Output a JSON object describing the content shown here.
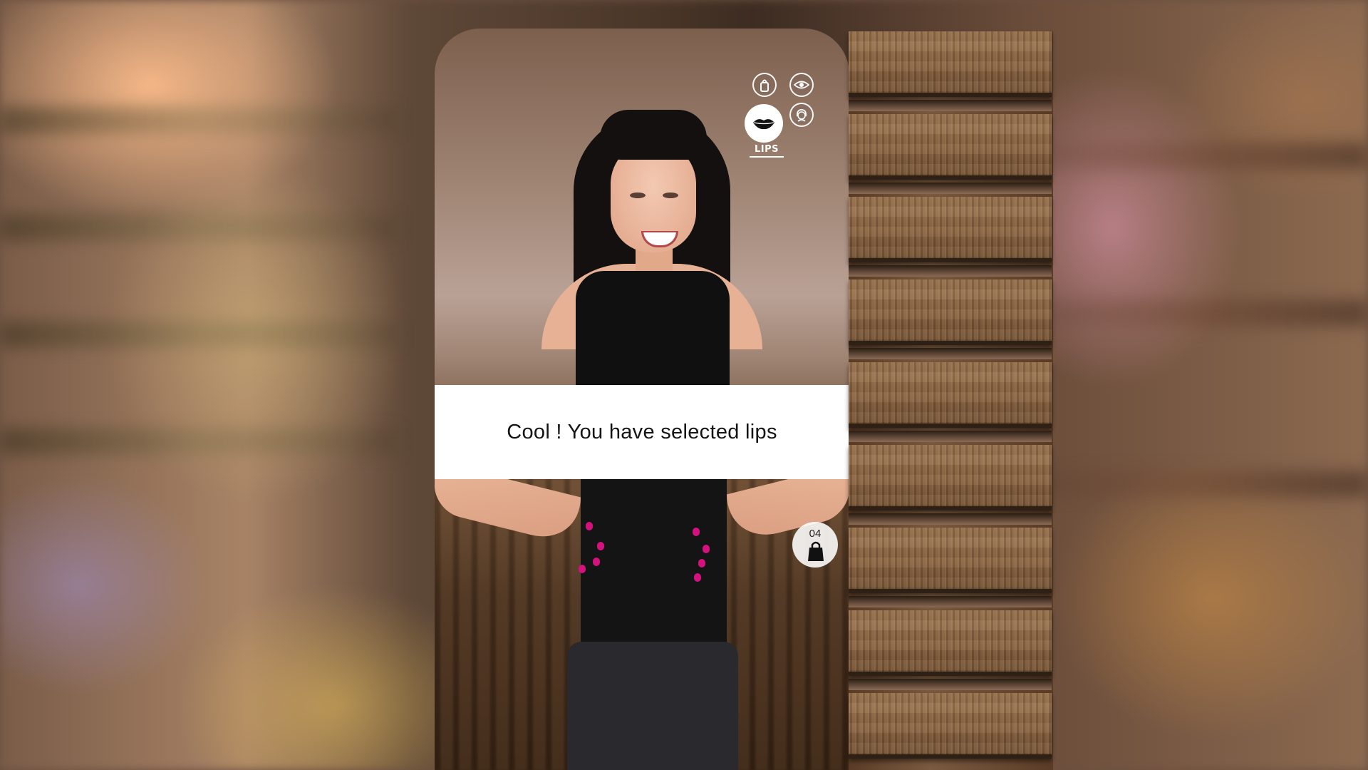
{
  "app": {
    "message": "Cool ! You have selected lips"
  },
  "categories": {
    "items": [
      {
        "name": "nails",
        "icon": "nail-polish-icon"
      },
      {
        "name": "eyes",
        "icon": "eye-icon"
      },
      {
        "name": "lips",
        "icon": "lips-icon"
      },
      {
        "name": "hair",
        "icon": "face-hair-icon"
      }
    ],
    "selected_label": "LIPS"
  },
  "bag": {
    "count": "04",
    "icon": "shopping-bag-icon"
  },
  "shelves": {
    "count": 9
  },
  "colors": {
    "nail_polish": "#d4127e",
    "banner_bg": "#ffffff"
  }
}
